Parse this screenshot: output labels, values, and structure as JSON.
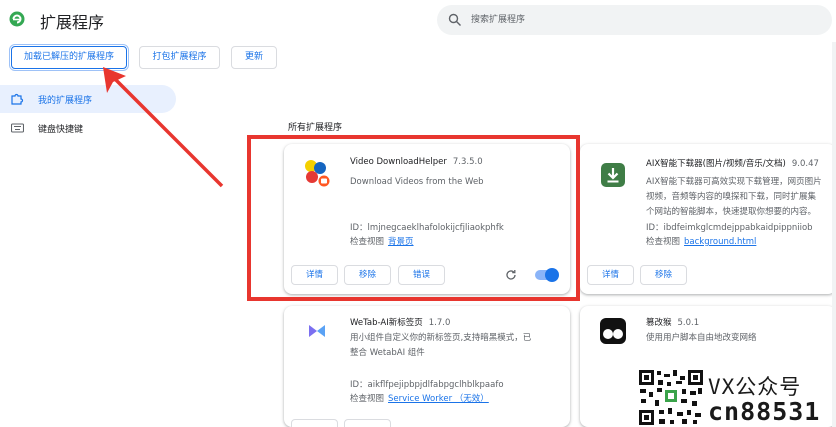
{
  "header": {
    "title": "扩展程序",
    "search_placeholder": "搜索扩展程序"
  },
  "toolbar": {
    "load_unpacked": "加载已解压的扩展程序",
    "pack_extension": "打包扩展程序",
    "update": "更新"
  },
  "sidebar": {
    "items": [
      {
        "label": "我的扩展程序",
        "icon": "extension-icon",
        "active": true
      },
      {
        "label": "键盘快捷键",
        "icon": "keyboard-icon",
        "active": false
      }
    ]
  },
  "main": {
    "section_title": "所有扩展程序",
    "extensions": [
      {
        "name": "Video DownloadHelper",
        "version": "7.3.5.0",
        "description": [
          "Download Videos from the Web"
        ],
        "id_line": "ID：lmjnegcaeklhafolokijcfjliaokphfk",
        "inspect_label": "检查视图",
        "inspect_link": "背景页",
        "buttons": [
          "详情",
          "移除",
          "错误"
        ],
        "enabled": true,
        "icon": "video-downloadhelper-icon"
      },
      {
        "name": "AIX智能下载器(图片/视频/音乐/文档)",
        "version": "9.0.47",
        "description": [
          "AIX智能下载器可高效实现下载管理，网页图片",
          "视频，音频等内容的嗅探和下载，同时扩展集",
          "个网站的智能脚本，快速提取你想要的内容。"
        ],
        "id_line": "ID：ibdfeimkglcmdejppabkaidpippniiob",
        "inspect_label": "检查视图",
        "inspect_link": "background.html",
        "buttons": [
          "详情",
          "移除"
        ],
        "icon": "download-arrow-icon"
      },
      {
        "name": "WeTab-AI新标签页",
        "version": "1.7.0",
        "description": [
          "用小组件自定义你的新标签页,支持暗黑模式，已",
          "整合 WetabAI 组件"
        ],
        "id_line": "ID：aikflfpejipbpjdlfabpgclhblkpaafo",
        "inspect_label": "检查视图",
        "inspect_link": "Service Worker （无效）",
        "icon": "wetab-icon"
      },
      {
        "name": "篡改猴",
        "version": "5.0.1",
        "description": [
          "使用用户脚本自由地改变网络"
        ],
        "icon": "tampermonkey-icon"
      }
    ]
  },
  "watermark": {
    "line1": "VX公众号",
    "line2": "cn88531"
  },
  "colors": {
    "accent": "#1a73e8",
    "annotation": "#e8362f",
    "nav_active_bg": "#e8f0fe"
  }
}
